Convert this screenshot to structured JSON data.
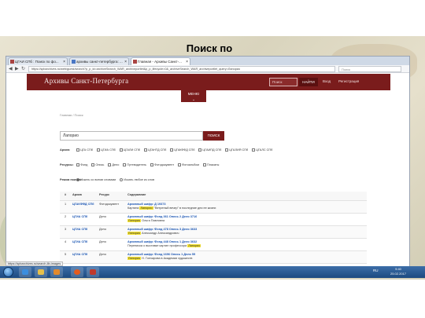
{
  "slide": {
    "title": "Поиск по фамилии"
  },
  "browser": {
    "tabs": [
      {
        "label": "ЦГАИ СПб : Поиск по фо..."
      },
      {
        "label": "архивы санкт-петербурга: ..."
      },
      {
        "label": "Главная - Архивы Санкт-..."
      }
    ],
    "url": "https://spbarchives.ru/web/guest/search?p_p_id=archiveSearch_WAR_archiveportlet&p_p_lifecycle=0&_archiveSearch_WAR_archiveportlet_query=Лапорио",
    "search_placeholder": "Поиск",
    "status_url": "https://spbarchives.ru/search-lib-images"
  },
  "site": {
    "title": "Архивы Санкт-Петербурга",
    "search_placeholder": "Поиск",
    "search_button": "НАЙТИ",
    "login": "Вход",
    "register": "Регистрация",
    "menu_button": "МЕНЮ"
  },
  "breadcrumb": "Главная / Поиск",
  "query": {
    "value": "Лапорио",
    "button": "ПОИСК"
  },
  "filters": {
    "archives_label": "Архив:",
    "archives": [
      "ЦГА СПб",
      "ЦГИА СПб",
      "ЦГАЛИ СПб",
      "ЦГАНТД СПб",
      "ЦГАКФФД СПб",
      "ЦГАИПД СПб",
      "ЦГАЛИЯ СПб",
      "ЦГАЛС СПб"
    ],
    "resources_label": "Ресурсы:",
    "resources": [
      "Фонд",
      "Опись",
      "Дело",
      "Путеводитель",
      "Фотодокумент",
      "Фотоальбом",
      "Плакаты"
    ],
    "mode_label": "Режим поиска:",
    "modes": [
      {
        "label": "Искать со всеми словами",
        "selected": true
      },
      {
        "label": "Искать любое из слов",
        "selected": false
      }
    ]
  },
  "results": {
    "columns": [
      "#",
      "Архив",
      "Ресурс",
      "Содержание"
    ],
    "rows": [
      {
        "num": "1",
        "archive": "ЦГАКФФД СПб",
        "resource": "Фотодокумент",
        "code": "Архивный шифр: Д 19373",
        "pre": "Картина ",
        "hit": "Лапорио",
        "post": " \"Ветреный вечер\" в последние дни ее жизни"
      },
      {
        "num": "2",
        "archive": "ЦГИА СПб",
        "resource": "Дело",
        "code": "Архивный шифр: Фонд 361 Опись 2 Дело 3716",
        "pre": "",
        "hit": "Лапорио",
        "post": " Ольга Павловна"
      },
      {
        "num": "3",
        "archive": "ЦГИА СПб",
        "resource": "Дело",
        "code": "Архивный шифр: Фонд 478 Опись 3 Дело 3633",
        "pre": "",
        "hit": "Лапорио",
        "post": " Александр Александрович"
      },
      {
        "num": "4",
        "archive": "ЦГИА СПб",
        "resource": "Дело",
        "code": "Архивный шифр: Фонд 448 Опись 1 Дело 3632",
        "pre": "Переписка о выставке картин профессора ",
        "hit": "Лапорио",
        "post": ""
      },
      {
        "num": "5",
        "archive": "ЦГИА СПб",
        "resource": "Дело",
        "code": "Архивный шифр: Фонд 1696 Опись 1 Дело 55",
        "pre": "",
        "hit": "Лапорио",
        "post": " Н. Гончарова в Академии художеств"
      }
    ]
  },
  "taskbar": {
    "lang": "RU",
    "time": "9:40",
    "date": "25.02.2017"
  }
}
